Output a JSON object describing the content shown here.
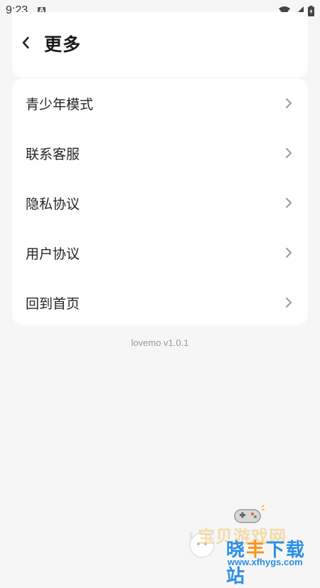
{
  "status_bar": {
    "time": "9:23",
    "app_icon_letter": "A",
    "icons": [
      "wifi-icon",
      "signal-icon",
      "battery-icon"
    ]
  },
  "header": {
    "title": "更多",
    "back_icon": "chevron-left-icon"
  },
  "menu": {
    "items": [
      {
        "label": "青少年模式"
      },
      {
        "label": "联系客服"
      },
      {
        "label": "隐私协议"
      },
      {
        "label": "用户协议"
      },
      {
        "label": "回到首页"
      }
    ],
    "chevron_icon": "chevron-right-icon"
  },
  "footer": {
    "version": "lovemo v1.0.1"
  },
  "watermark": {
    "line1": "宝贝游戏网",
    "line2_part1": "晓",
    "line2_part2": "丰",
    "line2_part3": "下",
    "line2_part4": "载站",
    "url": "www.xfhygs.com"
  },
  "colors": {
    "background": "#f6f6f6",
    "card": "#ffffff",
    "text": "#262626",
    "chevron": "#999999",
    "version_text": "#9a9a9a"
  }
}
